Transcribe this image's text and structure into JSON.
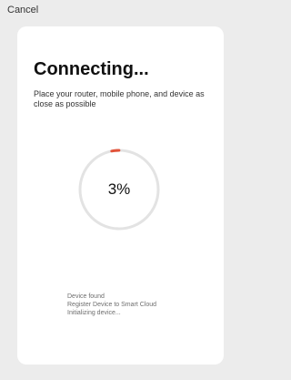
{
  "header": {
    "cancel_label": "Cancel"
  },
  "card": {
    "title": "Connecting...",
    "subtitle": "Place your router, mobile phone, and device as close as possible",
    "progress": {
      "value_label": "3%",
      "value": 0.03
    },
    "steps": [
      "Device found",
      "Register Device to Smart Cloud",
      "Initializing device..."
    ]
  },
  "colors": {
    "background": "#ececec",
    "card": "#ffffff",
    "ring_track": "#e3e3e3",
    "ring_progress": "#e2533a"
  }
}
